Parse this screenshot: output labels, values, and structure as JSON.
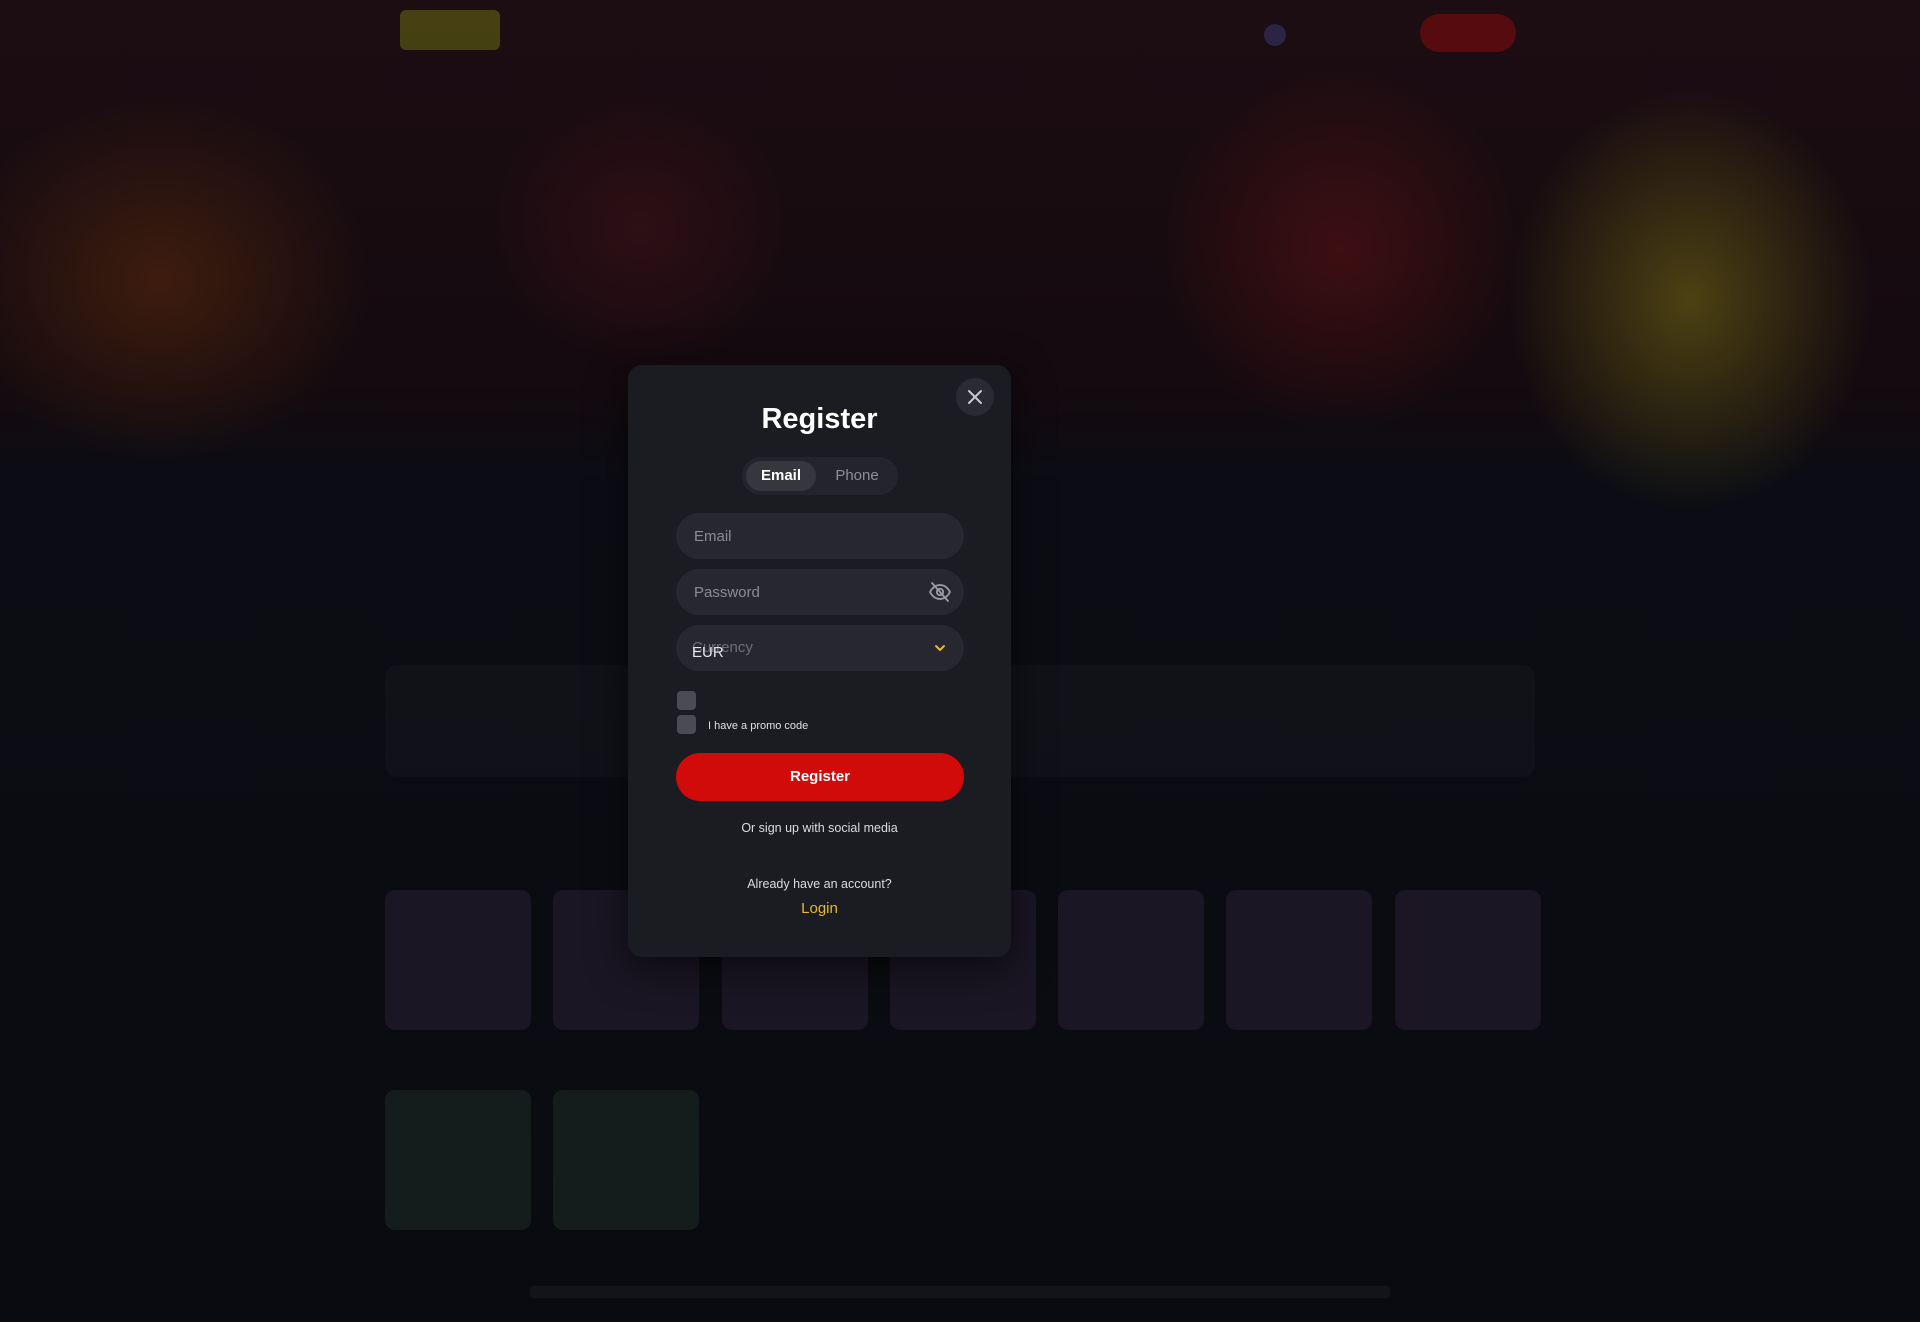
{
  "modal": {
    "title": "Register",
    "tabs": [
      {
        "label": "Email",
        "active": true
      },
      {
        "label": "Phone",
        "active": false
      }
    ],
    "email_placeholder": "Email",
    "password_placeholder": "Password",
    "currency_placeholder": "Currency",
    "currency_value": "EUR",
    "promo_label": "I have a promo code",
    "register_label": "Register",
    "social_text": "Or sign up with social media",
    "have_account_text": "Already have an account?",
    "login_label": "Login"
  },
  "colors": {
    "accent": "#d10a0a",
    "link": "#e8b92a",
    "modal_bg": "#1b1c22",
    "field_bg": "#27282f"
  },
  "icons": {
    "close": "close-icon",
    "password_visibility": "eye-off-icon",
    "select_arrow": "chevron-down-icon"
  }
}
